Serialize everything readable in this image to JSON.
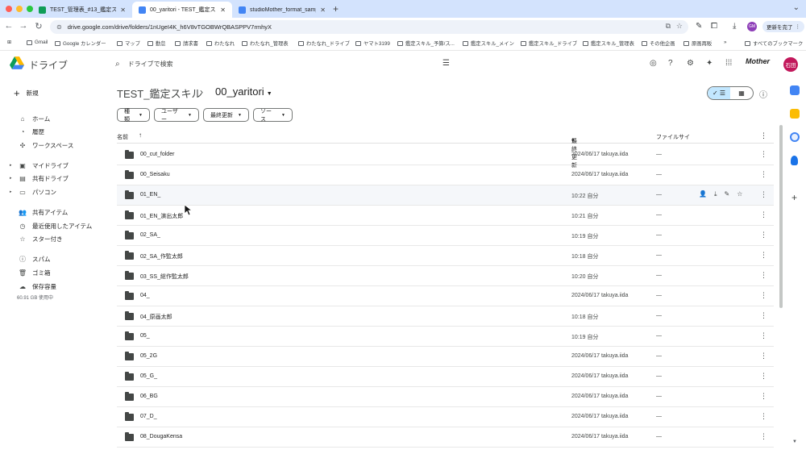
{
  "browser": {
    "tabs": [
      {
        "title": "TEST_管理表_#13_鑑定スキル",
        "active": false,
        "icon_color": "#0f9d58"
      },
      {
        "title": "00_yaritori - TEST_鑑定スキル",
        "active": true,
        "icon_color": "#4285f4"
      },
      {
        "title": "studioMother_format_sample",
        "active": false,
        "icon_color": "#4285f4"
      }
    ],
    "new_tab_label": "+",
    "url": "drive.google.com/drive/folders/1nUgeI4K_h6V8vTGOBWrQBASPPV7rmhyX",
    "profile_initials": "GM",
    "update_button": "更新を完了",
    "bookmarks": [
      "Gmail",
      "Google カレンダー",
      "マップ",
      "勤怠",
      "請求書",
      "わたなれ",
      "わたなれ_管理表",
      "わたなれ_ドライブ",
      "ヤマト3199",
      "鑑定スキル_予算/ス...",
      "鑑定スキル_メイン",
      "鑑定スキル_ドライブ",
      "鑑定スキル_管理表",
      "その他企画",
      "原画再販",
      "»",
      "すべてのブックマーク"
    ]
  },
  "drive": {
    "app_title": "ドライブ",
    "search_placeholder": "ドライブで検索",
    "brand_text": "Mother",
    "avatar_initials": "石田",
    "new_button": "新規",
    "nav": [
      {
        "label": "ホーム",
        "icon": "home-icon",
        "glyph": "⌂",
        "caret": false
      },
      {
        "label": "履歴",
        "icon": "bell-icon",
        "glyph": "◔",
        "caret": false
      },
      {
        "label": "ワークスペース",
        "icon": "workspace-icon",
        "glyph": "✣",
        "caret": false
      },
      {
        "label": "マイドライブ",
        "icon": "my-drive-icon",
        "glyph": "▣",
        "caret": true
      },
      {
        "label": "共有ドライブ",
        "icon": "shared-drive-icon",
        "glyph": "▤",
        "caret": true
      },
      {
        "label": "パソコン",
        "icon": "computer-icon",
        "glyph": "▭",
        "caret": true
      },
      {
        "label": "共有アイテム",
        "icon": "shared-icon",
        "glyph": "👥",
        "caret": false
      },
      {
        "label": "最近使用したアイテム",
        "icon": "recent-icon",
        "glyph": "◷",
        "caret": false
      },
      {
        "label": "スター付き",
        "icon": "star-icon",
        "glyph": "☆",
        "caret": false
      },
      {
        "label": "スパム",
        "icon": "spam-icon",
        "glyph": "ⓘ",
        "caret": false
      },
      {
        "label": "ゴミ箱",
        "icon": "trash-icon",
        "glyph": "🗑",
        "caret": false
      },
      {
        "label": "保存容量",
        "icon": "cloud-icon",
        "glyph": "☁",
        "caret": false
      }
    ],
    "storage_text": "60.91 GB 使用中",
    "breadcrumb_parent": "TEST_鑑定スキル",
    "breadcrumb_sep": "›",
    "breadcrumb_current": "00_yaritori",
    "filters": [
      "種類",
      "ユーザー",
      "最終更新",
      "ソース"
    ],
    "columns": {
      "name": "名前",
      "sort_arrow": "↑",
      "modified": "最終更新",
      "modified_sort": "▾",
      "size": "ファイルサイ"
    },
    "rows": [
      {
        "name": "00_cut_folder",
        "modified": "2024/06/17 takuya.iida",
        "size": "—"
      },
      {
        "name": "00_Seisaku",
        "modified": "2024/06/17 takuya.iida",
        "size": "—"
      },
      {
        "name": "01_EN_",
        "modified": "10:22 自分",
        "size": "—"
      },
      {
        "name": "01_EN_演出太郎",
        "modified": "10:21 自分",
        "size": "—"
      },
      {
        "name": "02_SA_",
        "modified": "10:19 自分",
        "size": "—"
      },
      {
        "name": "02_SA_作監太郎",
        "modified": "10:18 自分",
        "size": "—"
      },
      {
        "name": "03_SS_総作監太郎",
        "modified": "10:20 自分",
        "size": "—"
      },
      {
        "name": "04_",
        "modified": "2024/06/17 takuya.iida",
        "size": "—"
      },
      {
        "name": "04_原画太郎",
        "modified": "10:18 自分",
        "size": "—"
      },
      {
        "name": "05_",
        "modified": "10:19 自分",
        "size": "—"
      },
      {
        "name": "05_2G",
        "modified": "2024/06/17 takuya.iida",
        "size": "—"
      },
      {
        "name": "05_G_",
        "modified": "2024/06/17 takuya.iida",
        "size": "—"
      },
      {
        "name": "06_BG",
        "modified": "2024/06/17 takuya.iida",
        "size": "—"
      },
      {
        "name": "07_D_",
        "modified": "2024/06/17 takuya.iida",
        "size": "—"
      },
      {
        "name": "08_DougaKensa",
        "modified": "2024/06/17 takuya.iida",
        "size": "—"
      }
    ],
    "hovered_row": 2
  }
}
